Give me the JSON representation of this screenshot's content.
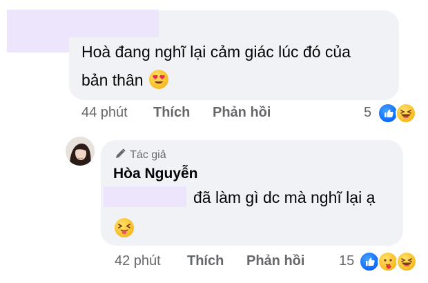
{
  "comment1": {
    "text_line1": "Hoà đang nghĩ lại cảm giác lúc đó của",
    "text_line2": "bản thân",
    "emoji_icon": "heart-eyes-emoji",
    "time": "44 phút",
    "like_label": "Thích",
    "reply_label": "Phản hồi",
    "reaction_count": "5",
    "reactions": [
      "like-icon",
      "haha-icon"
    ]
  },
  "reply1": {
    "author_badge": "Tác giả",
    "author_badge_icon": "pen-icon",
    "author_name": "Hòa Nguyễn",
    "text_line1": "đã làm gì dc mà nghĩ lại ạ",
    "emoji_icon": "tongue-out-squint-emoji",
    "time": "42 phút",
    "like_label": "Thích",
    "reply_label": "Phản hồi",
    "reaction_count": "15",
    "reactions": [
      "like-icon",
      "care-icon",
      "haha-icon"
    ]
  },
  "colors": {
    "bubble": "#f0f2f5",
    "redaction_mask": "#ede5fb",
    "meta_text": "#65676b",
    "like_blue": "#0866ff"
  }
}
